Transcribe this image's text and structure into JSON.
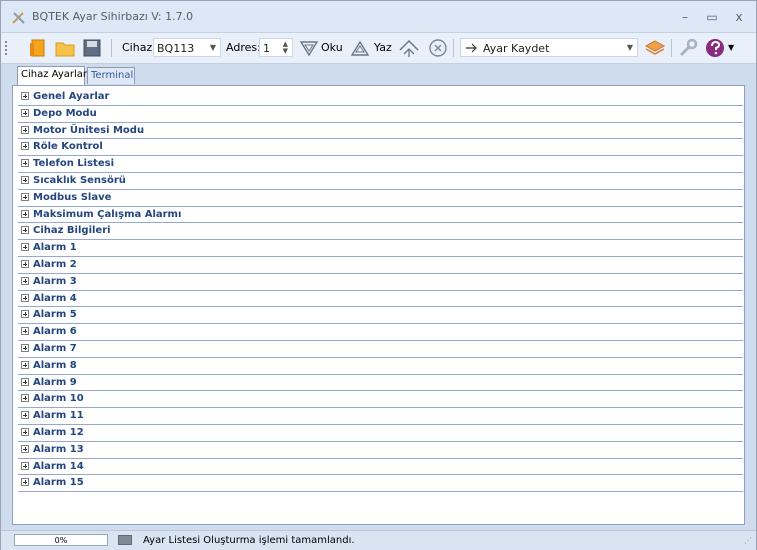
{
  "window": {
    "title": "BQTEK Ayar Sihirbazı   V: 1.7.0",
    "minimize": "–",
    "maximize": "▭",
    "close": "x"
  },
  "toolbar": {
    "cihaz_label": "Cihaz:",
    "cihaz_value": "BQ113",
    "adres_label": "Adres:",
    "adres_value": "1",
    "oku_label": "Oku",
    "yaz_label": "Yaz",
    "ayar_kaydet_label": "Ayar Kaydet"
  },
  "tabs": [
    {
      "label": "Cihaz Ayarları",
      "active": true
    },
    {
      "label": "Terminal",
      "active": false
    }
  ],
  "settings": [
    "Genel Ayarlar",
    "Depo Modu",
    "Motor Ünitesi Modu",
    "Röle Kontrol",
    "Telefon Listesi",
    "Sıcaklık Sensörü",
    "Modbus Slave",
    "Maksimum Çalışma Alarmı",
    "Cihaz Bilgileri",
    "Alarm 1",
    "Alarm 2",
    "Alarm 3",
    "Alarm 4",
    "Alarm 5",
    "Alarm 6",
    "Alarm 7",
    "Alarm 8",
    "Alarm 9",
    "Alarm 10",
    "Alarm 11",
    "Alarm 12",
    "Alarm 13",
    "Alarm 14",
    "Alarm 15"
  ],
  "status": {
    "progress": "0%",
    "progress_value": 0,
    "message": "Ayar Listesi Oluşturma işlemi tamamlandı."
  },
  "colors": {
    "accent": "#23467e",
    "row_border": "#94a9cc",
    "title_bg": "#dde8f6"
  }
}
